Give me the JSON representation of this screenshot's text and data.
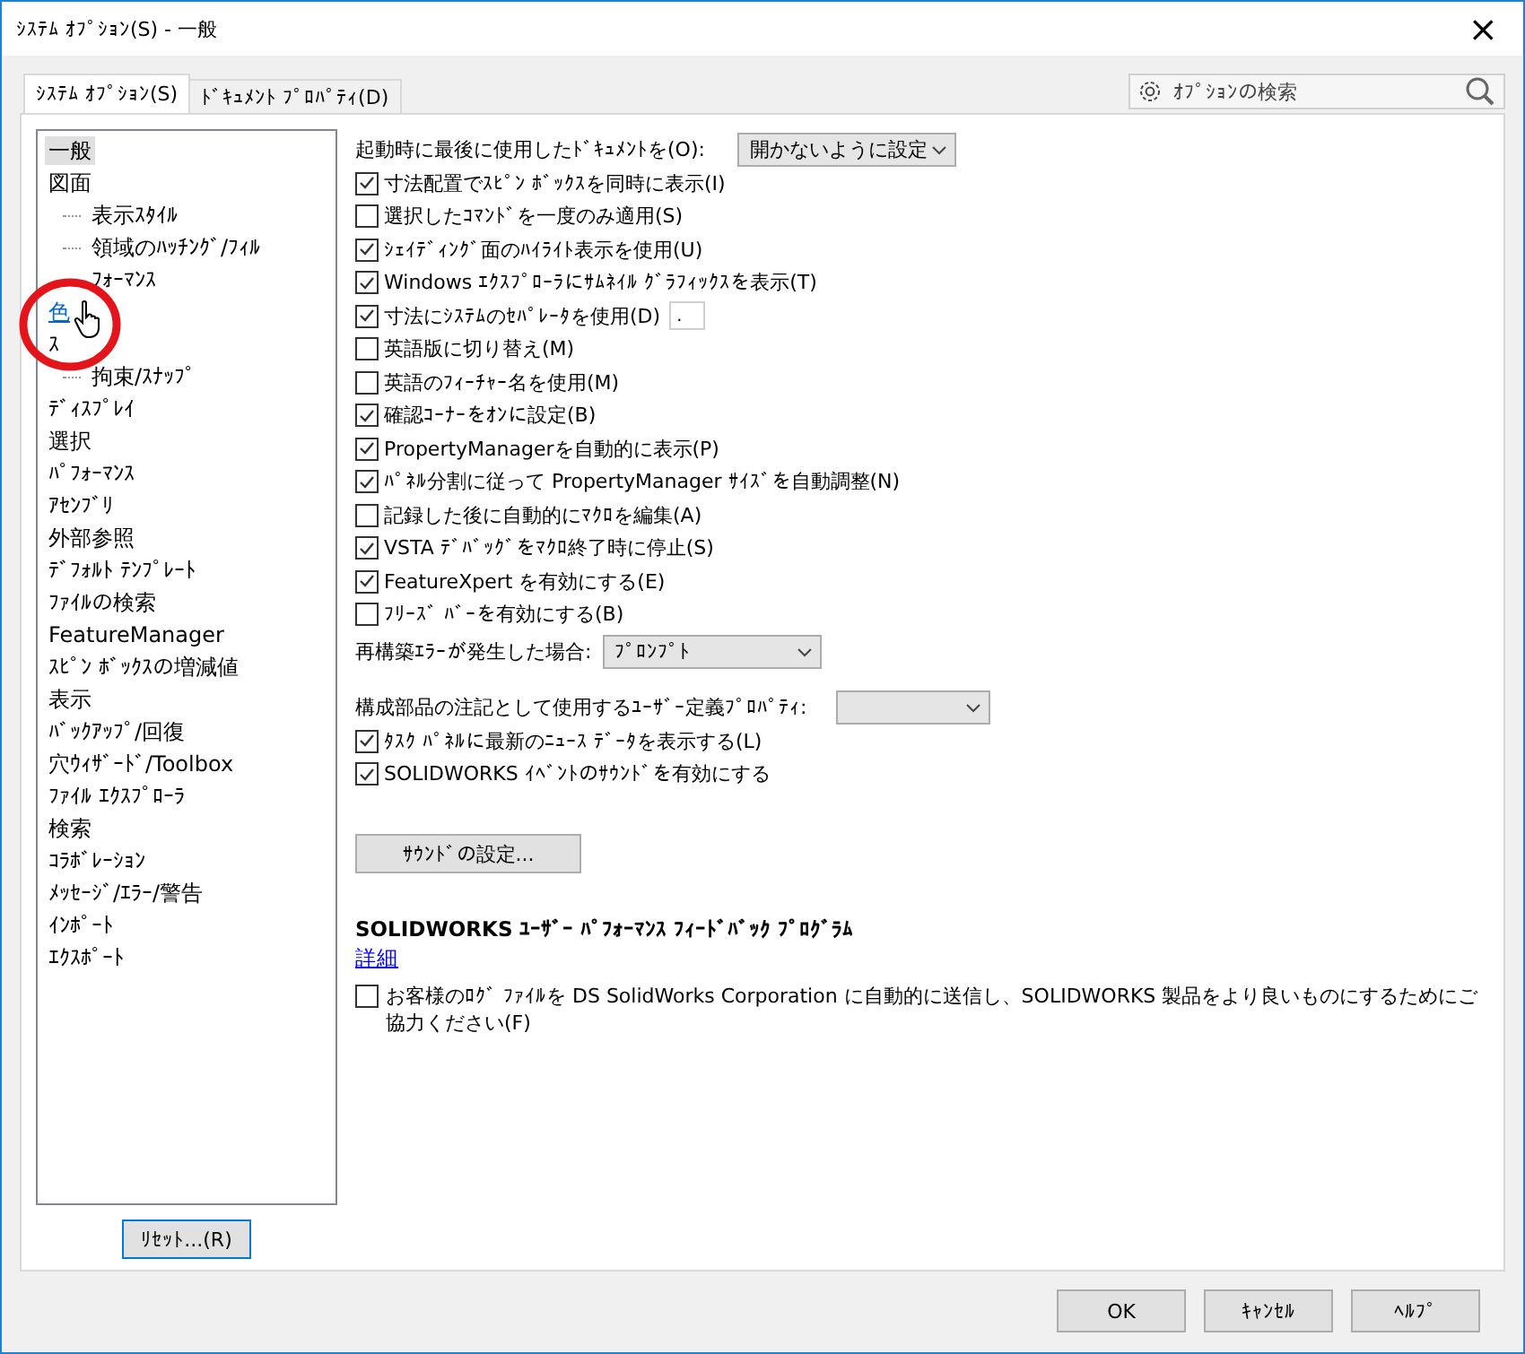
{
  "window": {
    "title": "ｼｽﾃﾑ ｵﾌﾟｼｮﾝ(S) - 一般",
    "close": "×"
  },
  "tabs": [
    {
      "label": "ｼｽﾃﾑ ｵﾌﾟｼｮﾝ(S)",
      "selected": true
    },
    {
      "label": "ﾄﾞｷｭﾒﾝﾄ ﾌﾟﾛﾊﾟﾃｨ(D)",
      "selected": false
    }
  ],
  "search": {
    "placeholder": "ｵﾌﾟｼｮﾝの検索"
  },
  "tree": [
    {
      "label": "一般",
      "selected": true,
      "hovered": false
    },
    {
      "label": "図面",
      "selected": false,
      "hovered": false,
      "children": [
        {
          "label": "表示ｽﾀｲﾙ",
          "selected": false,
          "hovered": false
        },
        {
          "label": "領域のﾊｯﾁﾝｸﾞ/ﾌｨﾙ",
          "selected": false,
          "hovered": false
        },
        {
          "label": "ﾌｫｰﾏﾝｽ",
          "selected": false,
          "hovered": false
        }
      ]
    },
    {
      "label": "色",
      "selected": false,
      "hovered": true
    },
    {
      "label": "ｽ",
      "selected": false,
      "hovered": false,
      "children": [
        {
          "label": "拘束/ｽﾅｯﾌﾟ",
          "selected": false,
          "hovered": false
        }
      ]
    },
    {
      "label": "ﾃﾞｨｽﾌﾟﾚｲ",
      "selected": false,
      "hovered": false
    },
    {
      "label": "選択",
      "selected": false,
      "hovered": false
    },
    {
      "label": "ﾊﾟﾌｫｰﾏﾝｽ",
      "selected": false,
      "hovered": false
    },
    {
      "label": "ｱｾﾝﾌﾞﾘ",
      "selected": false,
      "hovered": false
    },
    {
      "label": "外部参照",
      "selected": false,
      "hovered": false
    },
    {
      "label": "ﾃﾞﾌｫﾙﾄ ﾃﾝﾌﾟﾚｰﾄ",
      "selected": false,
      "hovered": false
    },
    {
      "label": "ﾌｧｲﾙの検索",
      "selected": false,
      "hovered": false
    },
    {
      "label": "FeatureManager",
      "selected": false,
      "hovered": false
    },
    {
      "label": "ｽﾋﾟﾝ ﾎﾞｯｸｽの増減値",
      "selected": false,
      "hovered": false
    },
    {
      "label": "表示",
      "selected": false,
      "hovered": false
    },
    {
      "label": "ﾊﾞｯｸｱｯﾌﾟ/回復",
      "selected": false,
      "hovered": false
    },
    {
      "label": "穴ｳｨｻﾞｰﾄﾞ/Toolbox",
      "selected": false,
      "hovered": false
    },
    {
      "label": "ﾌｧｲﾙ ｴｸｽﾌﾟﾛｰﾗ",
      "selected": false,
      "hovered": false
    },
    {
      "label": "検索",
      "selected": false,
      "hovered": false
    },
    {
      "label": "ｺﾗﾎﾞﾚｰｼｮﾝ",
      "selected": false,
      "hovered": false
    },
    {
      "label": "ﾒｯｾｰｼﾞ/ｴﾗｰ/警告",
      "selected": false,
      "hovered": false
    },
    {
      "label": "ｲﾝﾎﾟｰﾄ",
      "selected": false,
      "hovered": false
    },
    {
      "label": "ｴｸｽﾎﾟｰﾄ",
      "selected": false,
      "hovered": false
    }
  ],
  "reset_button": "ﾘｾｯﾄ...(R)",
  "options": [
    {
      "kind": "select",
      "label": "起動時に最後に使用したﾄﾞｷｭﾒﾝﾄを(O):",
      "value": "開かないように設定"
    },
    {
      "kind": "checkbox",
      "label": "寸法配置でｽﾋﾟﾝ ﾎﾞｯｸｽを同時に表示(I)",
      "checked": true
    },
    {
      "kind": "checkbox",
      "label": "選択したｺﾏﾝﾄﾞを一度のみ適用(S)",
      "checked": false
    },
    {
      "kind": "checkbox",
      "label": "ｼｪｲﾃﾞｨﾝｸﾞ面のﾊｲﾗｲﾄ表示を使用(U)",
      "checked": true
    },
    {
      "kind": "checkbox",
      "label": "Windows ｴｸｽﾌﾟﾛｰﾗにｻﾑﾈｲﾙ ｸﾞﾗﾌｨｯｸｽを表示(T)",
      "checked": true
    },
    {
      "kind": "checkbox-field",
      "label": "寸法にｼｽﾃﾑのｾﾊﾟﾚｰﾀを使用(D)",
      "checked": true,
      "separator": "."
    },
    {
      "kind": "checkbox",
      "label": "英語版に切り替え(M)",
      "checked": false
    },
    {
      "kind": "checkbox",
      "label": "英語のﾌｨｰﾁｬｰ名を使用(M)",
      "checked": false
    },
    {
      "kind": "checkbox",
      "label": "確認ｺｰﾅｰをｵﾝに設定(B)",
      "checked": true
    },
    {
      "kind": "checkbox",
      "label": "PropertyManagerを自動的に表示(P)",
      "checked": true
    },
    {
      "kind": "checkbox",
      "label": "ﾊﾟﾈﾙ分割に従って PropertyManager ｻｲｽﾞを自動調整(N)",
      "checked": true
    },
    {
      "kind": "checkbox",
      "label": "記録した後に自動的にﾏｸﾛを編集(A)",
      "checked": false
    },
    {
      "kind": "checkbox",
      "label": "VSTA ﾃﾞﾊﾞｯｸﾞをﾏｸﾛ終了時に停止(S)",
      "checked": true
    },
    {
      "kind": "checkbox",
      "label": "FeatureXpert を有効にする(E)",
      "checked": true
    },
    {
      "kind": "checkbox",
      "label": "ﾌﾘｰｽﾞ ﾊﾞｰを有効にする(B)",
      "checked": false
    },
    {
      "kind": "select",
      "label": "再構築ｴﾗｰが発生した場合:",
      "value": "ﾌﾟﾛﾝﾌﾟﾄ"
    },
    {
      "kind": "select-wide",
      "label": "構成部品の注記として使用するﾕｰｻﾞｰ定義ﾌﾟﾛﾊﾟﾃｨ:"
    },
    {
      "kind": "checkbox",
      "label": "ﾀｽｸ ﾊﾟﾈﾙに最新のﾆｭｰｽ ﾃﾞｰﾀを表示する(L)",
      "checked": true
    },
    {
      "kind": "checkbox",
      "label": "SOLIDWORKS ｲﾍﾞﾝﾄのｻｳﾝﾄﾞを有効にする",
      "checked": true
    }
  ],
  "sound_button": "ｻｳﾝﾄﾞの設定...",
  "feedback": {
    "heading": "SOLIDWORKS ﾕｰｻﾞｰ ﾊﾟﾌｫｰﾏﾝｽ ﾌｨｰﾄﾞﾊﾞｯｸ ﾌﾟﾛｸﾞﾗﾑ",
    "link": "詳細",
    "consent": "お客様のﾛｸﾞ ﾌｧｲﾙを DS SolidWorks Corporation に自動的に送信し、SOLIDWORKS 製品をより良いものにするためにご協力ください(F)",
    "checked": false
  },
  "buttons": [
    "OK",
    "ｷｬﾝｾﾙ",
    "ﾍﾙﾌﾟ"
  ]
}
